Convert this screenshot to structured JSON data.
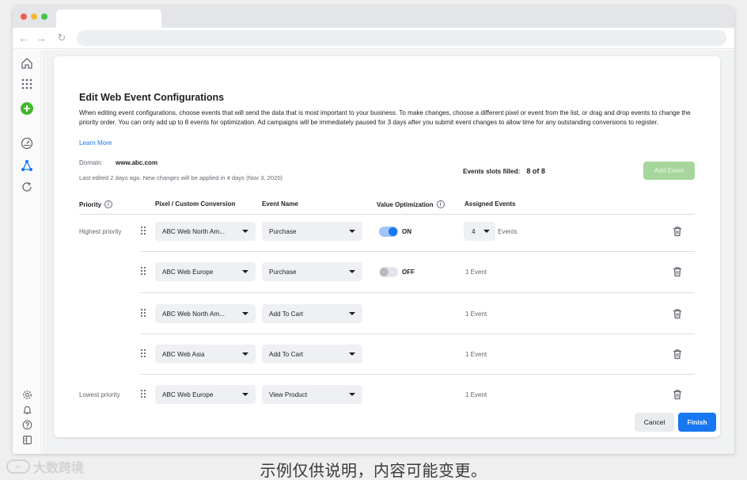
{
  "page": {
    "title": "Edit Web Event Configurations",
    "description": "When editing event configurations, choose events that will send the data that is most important to your business. To make changes, choose a different pixel or event from the list, or drag and drop events to change the priority order. You can only add up to 8 events for optimization. Ad campaigns will be immediately paused for 3 days after you submit event changes to allow time for any outstanding conversions to register.",
    "learn_more": "Learn More",
    "domain_label": "Domain:",
    "domain_value": "www.abc.com",
    "last_edited": "Last edited 2 days ago. New changes will be applied in 4 days (Nov 3, 2020)",
    "slots_label": "Events slots filled:",
    "slots_value": "8 of 8",
    "add_event": "Add Event"
  },
  "table": {
    "headers": {
      "priority": "Priority",
      "pixel": "Pixel / Custom Conversion",
      "event": "Event Name",
      "value_opt": "Value Optimization",
      "assigned": "Assigned Events"
    },
    "rows": [
      {
        "priority": "Highest priority",
        "pixel": "ABC Web North Am...",
        "event": "Purchase",
        "toggle": "ON",
        "assigned_count": "4",
        "assigned_suffix": "Events"
      },
      {
        "priority": "",
        "pixel": "ABC Web Europe",
        "event": "Purchase",
        "toggle": "OFF",
        "assigned": "1 Event"
      },
      {
        "priority": "",
        "pixel": "ABC Web North Am...",
        "event": "Add To Cart",
        "assigned": "1 Event"
      },
      {
        "priority": "",
        "pixel": "ABC Web Asia",
        "event": "Add To Cart",
        "assigned": "1 Event"
      },
      {
        "priority": "Lowest priority",
        "pixel": "ABC Web Europe",
        "event": "View Product",
        "assigned": "1 Event"
      }
    ]
  },
  "footer": {
    "cancel": "Cancel",
    "finish": "Finish"
  },
  "overlay": {
    "watermark": "大数跨境",
    "caption": "示例仅供说明，内容可能变更。"
  },
  "colors": {
    "primary": "#1877f2",
    "add_event_bg": "#a6d69b",
    "create_icon": "#42b72a"
  },
  "icons": {
    "rail": [
      "home-icon",
      "apps-grid-icon",
      "create-plus-icon",
      "dashboard-gauge-icon",
      "events-manager-icon",
      "refresh-icon",
      "settings-gear-icon",
      "notifications-bell-icon",
      "help-icon",
      "panel-icon"
    ]
  }
}
